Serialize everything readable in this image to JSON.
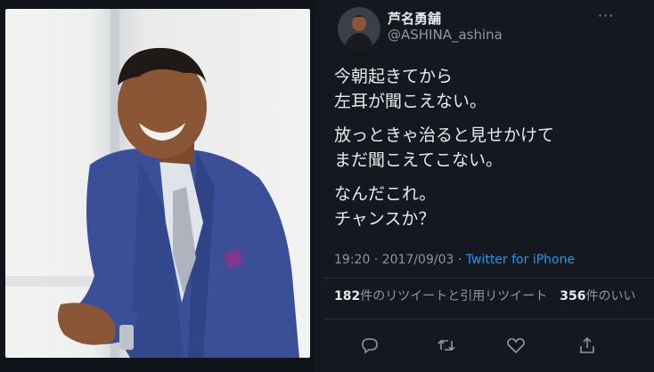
{
  "tweet": {
    "display_name": "芦名勇舗",
    "handle": "@ASHINA_ashina",
    "more_icon": "more-icon",
    "body": [
      "今朝起きてから",
      "左耳が聞こえない。",
      "放っときゃ治ると見せかけて",
      "まだ聞こえてこない。",
      "なんだこれ。",
      "チャンスか？"
    ],
    "time": "19:20 · 2017/09/03 · ",
    "source": "Twitter for iPhone",
    "retweets_count": "182",
    "retweets_label": "件のリツイートと引用リツイート",
    "likes_count": "356",
    "likes_label": "件のいい"
  },
  "actions": {
    "reply_icon": "reply-icon",
    "retweet_icon": "retweet-icon",
    "like_icon": "heart-icon",
    "share_icon": "share-icon"
  },
  "colors": {
    "background": "#15181f",
    "text": "#e7e9ea",
    "muted": "#8b98a5",
    "link": "#1d9bf0"
  }
}
